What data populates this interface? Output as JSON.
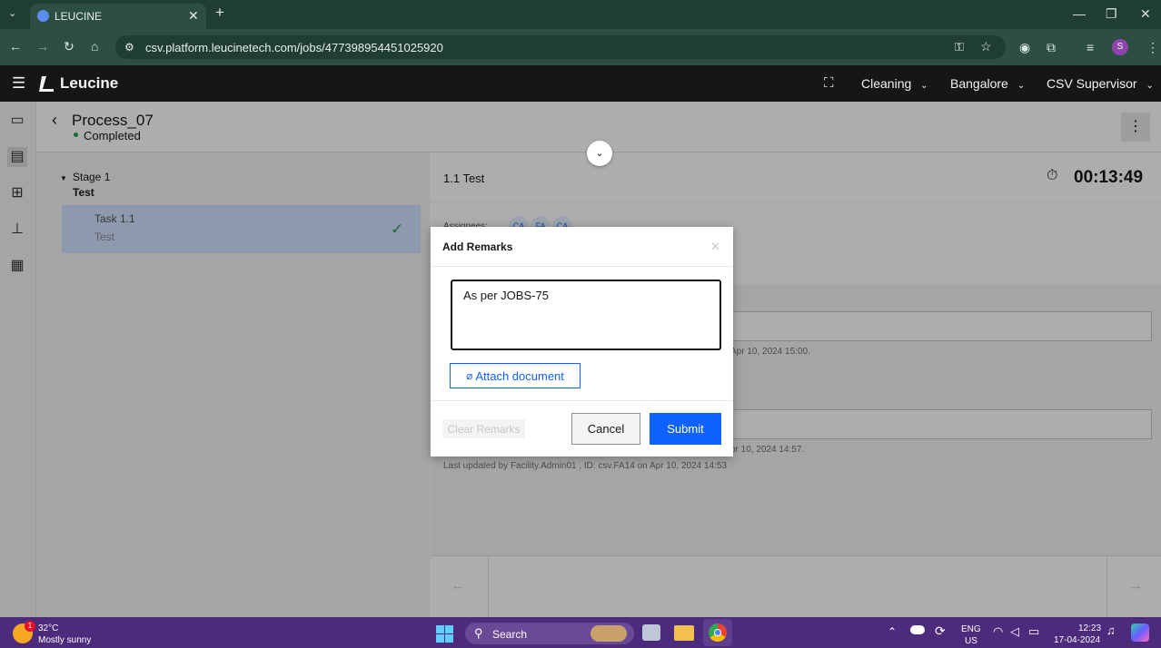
{
  "browser": {
    "tab_title": "LEUCINE",
    "url": "csv.platform.leucinetech.com/jobs/477398954451025920"
  },
  "app": {
    "brand": "Leucine",
    "menus": [
      "Cleaning",
      "Bangalore",
      "CSV Supervisor"
    ]
  },
  "job": {
    "title": "Process_07",
    "status": "Completed",
    "status_color": "#24a148"
  },
  "stage": {
    "label": "Stage 1",
    "name": "Test"
  },
  "task": {
    "label": "Task 1.1",
    "name": "Test"
  },
  "right": {
    "task_title": "1.1 Test",
    "timer": "00:13:49",
    "assignees_label": "Assignees:",
    "assignees": [
      "CA",
      "FA",
      "CA"
    ],
    "note1": "Apr 10, 2024 15:00.",
    "note2": "pr 10, 2024 14:57.",
    "last_updated": "Last updated by Facility.Admin01 , ID: csv.FA14 on Apr 10, 2024 14:53"
  },
  "modal": {
    "title": "Add Remarks",
    "remarks_value": "As per JOBS-75",
    "attach_label": "Attach document",
    "clear_label": "Clear Remarks",
    "cancel_label": "Cancel",
    "submit_label": "Submit",
    "accent": "#0f62fe"
  },
  "taskbar": {
    "weather_temp": "32°C",
    "weather_desc": "Mostly sunny",
    "weather_badge": "1",
    "search_label": "Search",
    "lang_line1": "ENG",
    "lang_line2": "US",
    "time": "12:23",
    "date": "17-04-2024"
  }
}
